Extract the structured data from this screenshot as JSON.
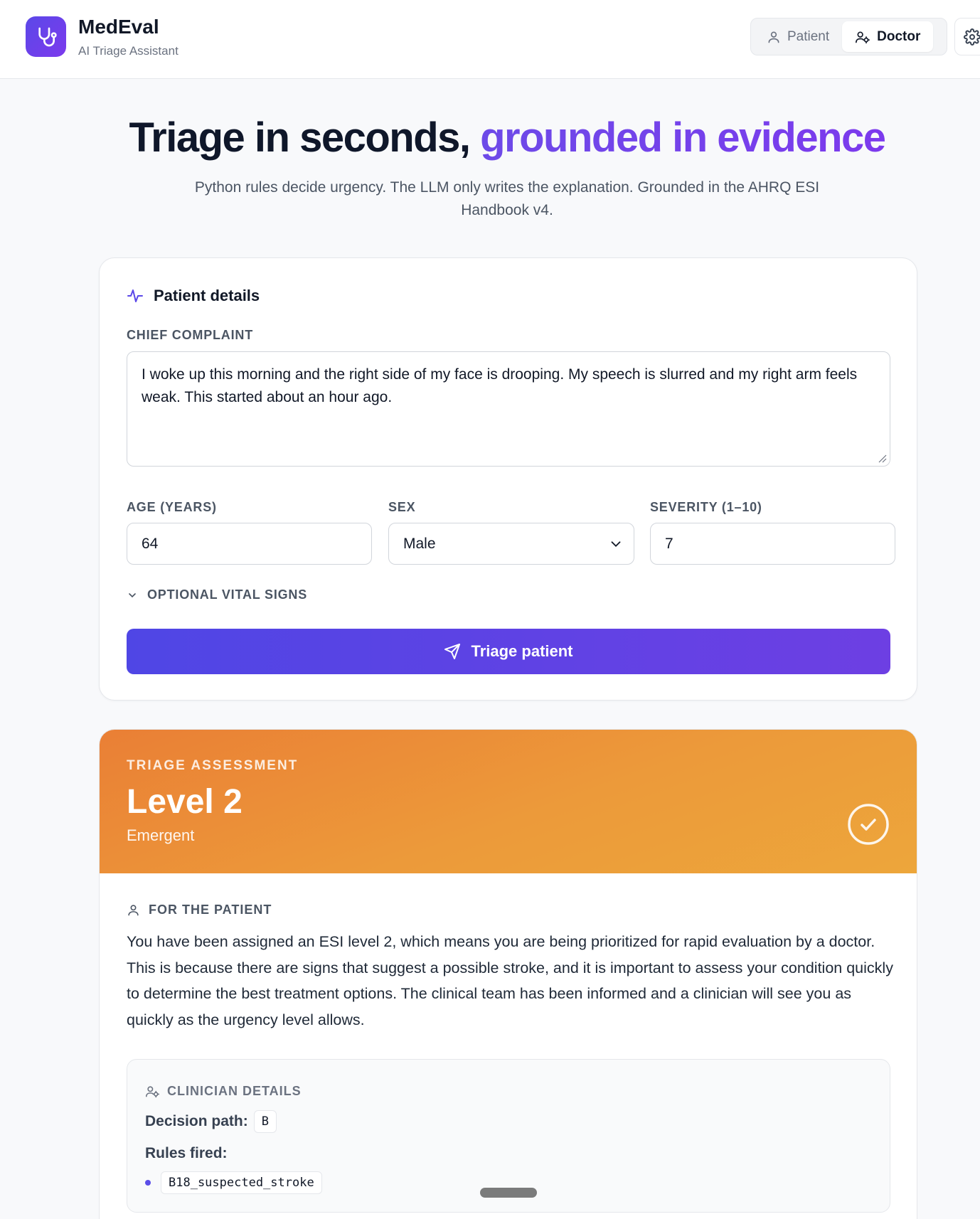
{
  "header": {
    "brand_title": "MedEval",
    "brand_subtitle": "AI Triage Assistant",
    "modes": [
      {
        "label": "Patient",
        "active": false,
        "icon": "user-icon"
      },
      {
        "label": "Doctor",
        "active": true,
        "icon": "user-cog-icon"
      }
    ],
    "settings_icon": "gear-icon"
  },
  "hero": {
    "title_plain": "Triage in seconds, ",
    "title_accent": "grounded in evidence",
    "subtitle": "Python rules decide urgency. The LLM only writes the explanation. Grounded in the AHRQ ESI Handbook v4."
  },
  "form": {
    "section_title": "Patient details",
    "chief_complaint_label": "CHIEF COMPLAINT",
    "chief_complaint_value": "I woke up this morning and the right side of my face is drooping. My speech is slurred and my right arm feels weak. This started about an hour ago.",
    "age_label": "AGE (YEARS)",
    "age_value": "64",
    "sex_label": "SEX",
    "sex_value": "Male",
    "severity_label": "SEVERITY (1–10)",
    "severity_value": "7",
    "vitals_toggle_label": "OPTIONAL VITAL SIGNS",
    "submit_label": "Triage patient"
  },
  "result": {
    "kicker": "TRIAGE ASSESSMENT",
    "level": "Level 2",
    "level_description": "Emergent",
    "patient_section_label": "FOR THE PATIENT",
    "patient_text": "You have been assigned an ESI level 2, which means you are being prioritized for rapid evaluation by a doctor. This is because there are signs that suggest a possible stroke, and it is important to assess your condition quickly to determine the best treatment options. The clinical team has been informed and a clinician will see you as quickly as the urgency level allows.",
    "clinician_label": "CLINICIAN DETAILS",
    "decision_path_label": "Decision path:",
    "decision_path_value": "B",
    "rules_fired_label": "Rules fired:",
    "rules_fired": [
      "B18_suspected_stroke"
    ],
    "colors": {
      "banner_start": "#ea7f35",
      "banner_end": "#eda63b"
    }
  },
  "colors": {
    "accent": "#5b48e8",
    "accent_2": "#7c3aed"
  }
}
